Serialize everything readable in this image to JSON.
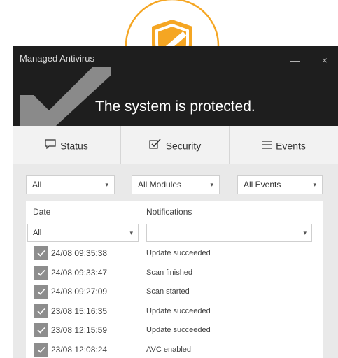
{
  "window": {
    "title": "Managed Antivirus",
    "minimize_label": "—",
    "close_label": "×"
  },
  "banner": {
    "status_text": "The system is protected."
  },
  "brand": {
    "shield_color": "#F5A623",
    "shield_icon": "shield-icon"
  },
  "tabs": [
    {
      "label": "Status",
      "icon": "speech-bubble-icon"
    },
    {
      "label": "Security",
      "icon": "checkbox-icon"
    },
    {
      "label": "Events",
      "icon": "menu-icon"
    }
  ],
  "filters": {
    "category": "All",
    "modules": "All Modules",
    "events": "All Events"
  },
  "table": {
    "col_date": "Date",
    "col_notifications": "Notifications",
    "date_filter": "All",
    "notification_filter": "",
    "rows": [
      {
        "date": "24/08 09:35:38",
        "message": "Update succeeded"
      },
      {
        "date": "24/08 09:33:47",
        "message": "Scan finished"
      },
      {
        "date": "24/08 09:27:09",
        "message": "Scan started"
      },
      {
        "date": "23/08 15:16:35",
        "message": "Update succeeded"
      },
      {
        "date": "23/08 12:15:59",
        "message": "Update succeeded"
      },
      {
        "date": "23/08 12:08:24",
        "message": "AVC enabled"
      }
    ]
  }
}
